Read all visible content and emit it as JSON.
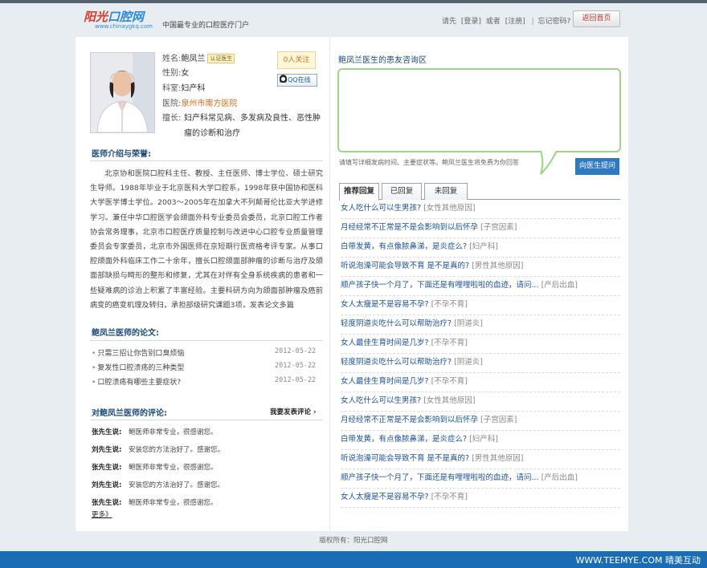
{
  "header": {
    "logo_text_a": "阳光",
    "logo_text_b": "口腔网",
    "logo_domain": "www.chinaygkq.com",
    "tagline": "中国最专业的口腔医疗门户",
    "links": {
      "please": "请先",
      "login": "[登录]",
      "or": "或者",
      "register": "[注册]",
      "sep": "|",
      "forgot": "忘记密码?"
    },
    "back_home": "返回首页"
  },
  "doctor": {
    "name_label": "姓名:",
    "name": "鲍凤兰",
    "cert_badge": "认证医生",
    "gender_label": "性别:",
    "gender": "女",
    "dept_label": "科室:",
    "dept": "妇产科",
    "hospital_label": "医院:",
    "hospital": "泉州市南方医院",
    "speciality_label": "擅长:",
    "speciality": "妇产科常见病、多发病及良性、恶性肿瘤的诊断和治疗",
    "follow": "0人关注",
    "qq": "QQ在线"
  },
  "intro": {
    "title": "医师介绍与荣誉:",
    "text": "北京协和医院口腔科主任、教授、主任医师、博士学位、硕士研究生导师。1988年毕业于北京医科大学口腔系，1998年获中国协和医科大学医学博士学位。2003～2005年在加拿大不列颠哥伦比亚大学进修学习。兼任中华口腔医学会颌面外科专业委员会委员，北京口腔工作者协会常务理事，北京市口腔医疗质量控制与改进中心口腔专业质量管理委员会专家委员，北京市外国医师在京短期行医资格考评专家。从事口腔颌面外科临床工作二十余年，擅长口腔颌面部肿瘤的诊断与治疗及颌面部缺损与畸形的整形和修复，尤其在对伴有全身系统疾病的患者和一些疑难病的诊治上积累了丰富经验。主要科研方向为颌面部肿瘤及癌前病变的癌变机理及转归，承担部级研究课题3项，发表论文多篇"
  },
  "papers": {
    "title": "鲍凤兰医师的论文:",
    "items": [
      {
        "title": "只需三招让你告别口臭烦恼",
        "date": "2012-05-22"
      },
      {
        "title": "复发性口腔溃疡的三种类型",
        "date": "2012-05-22"
      },
      {
        "title": "口腔溃疡有哪些主要症状?",
        "date": "2012-05-22"
      }
    ]
  },
  "comments": {
    "title": "对鲍凤兰医师的评论:",
    "post_link": "我要发表评论",
    "items": [
      {
        "who": "张先生说:",
        "text": "鲍医师非常专业，很感谢您。"
      },
      {
        "who": "刘先生说:",
        "text": "安装您的方法治好了。感谢您。"
      },
      {
        "who": "张先生说:",
        "text": "鲍医师非常专业，很感谢您。"
      },
      {
        "who": "刘先生说:",
        "text": "安装您的方法治好了。感谢您。"
      },
      {
        "who": "张先生说:",
        "text": "鲍医师非常专业，很感谢您。"
      }
    ],
    "more": "更多》"
  },
  "consult": {
    "title": "鲍凤兰医生的患友咨询区",
    "hint": "请填写详细发病时间、主要症状等。鲍凤兰医生将免费为你回答",
    "ask_button": "向医生提问",
    "textarea_value": ""
  },
  "tabs": [
    "推荐回复",
    "已回复",
    "未回复"
  ],
  "questions": [
    {
      "q": "女人吃什么可以生男孩?",
      "cat": "[女性其他原因]"
    },
    {
      "q": "月经经常不正常是不是会影响到以后怀孕",
      "cat": "[子宫因素]"
    },
    {
      "q": "白带发黄，有点像脓鼻涕，是炎症么?",
      "cat": "[妇产科]"
    },
    {
      "q": "听说泡澡可能会导致不育 是不是真的?",
      "cat": "[男性其他原因]"
    },
    {
      "q": "顺产孩子快一个月了，下面还是有哩哩啦啦的血迹，请问...",
      "cat": "[产后出血]"
    },
    {
      "q": "女人太瘦是不是容易不孕?",
      "cat": "[不孕不育]"
    },
    {
      "q": "轻度阴道炎吃什么可以帮助治疗?",
      "cat": "[阴道炎]"
    },
    {
      "q": "女人最佳生育时间是几岁?",
      "cat": "[不孕不育]"
    },
    {
      "q": "轻度阴道炎吃什么可以帮助治疗?",
      "cat": "[阴道炎]"
    },
    {
      "q": "女人最佳生育时间是几岁?",
      "cat": "[不孕不育]"
    },
    {
      "q": "女人吃什么可以生男孩?",
      "cat": "[女性其他原因]"
    },
    {
      "q": "月经经常不正常是不是会影响到以后怀孕",
      "cat": "[子宫因素]"
    },
    {
      "q": "白带发黄，有点像脓鼻涕，是炎症么?",
      "cat": "[妇产科]"
    },
    {
      "q": "听说泡澡可能会导致不育 是不是真的?",
      "cat": "[男性其他原因]"
    },
    {
      "q": "顺产孩子快一个月了，下面还是有哩哩啦啦的血迹，请问...",
      "cat": "[产后出血]"
    },
    {
      "q": "女人太瘦是不是容易不孕?",
      "cat": "[不孕不育]"
    }
  ],
  "footer": {
    "copyright": "版权所有：阳光口腔网",
    "watermark": "WWW.TEEMYE.COM 晴美互动"
  },
  "colors": {
    "accent_blue": "#2f79bf",
    "question_blue": "#1a4f9c",
    "green_border": "#9ed38a",
    "orange": "#e06c1a"
  }
}
